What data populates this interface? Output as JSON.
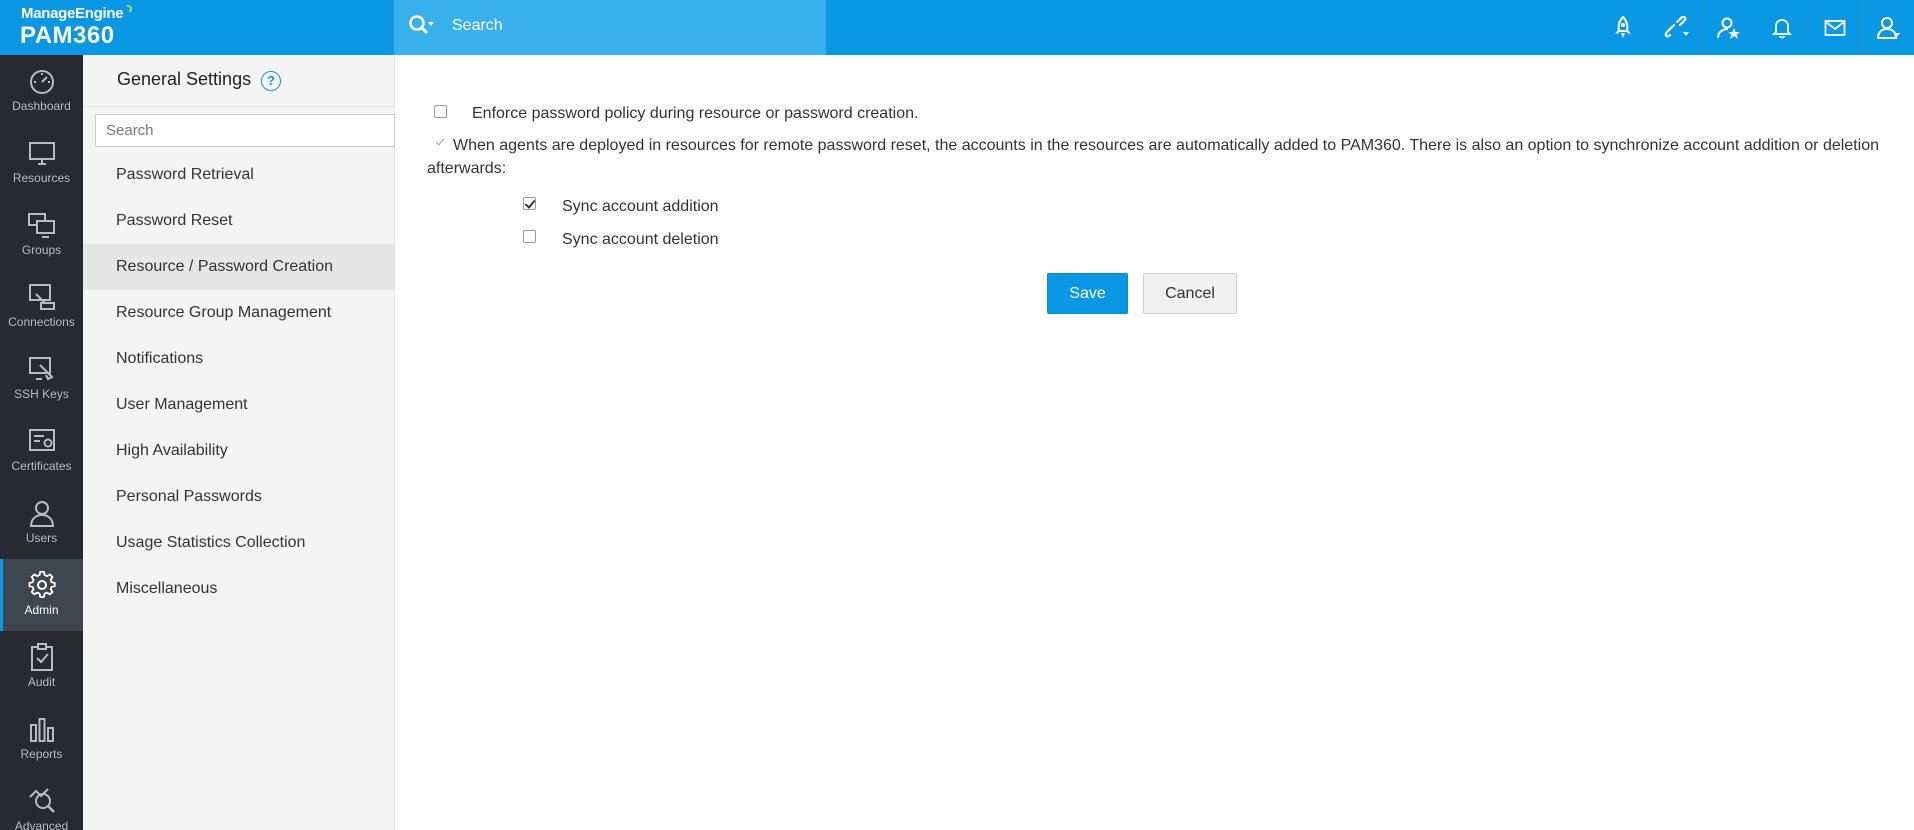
{
  "brand": {
    "vendor": "ManageEngine",
    "product": "PAM360"
  },
  "search": {
    "label": "Search"
  },
  "top_icons": [
    "rocket-icon",
    "link-icon",
    "star-person-icon",
    "bell-icon",
    "mail-icon",
    "user-icon"
  ],
  "leftnav": {
    "items": [
      {
        "label": "Dashboard",
        "icon": "dashboard-icon"
      },
      {
        "label": "Resources",
        "icon": "monitor-icon"
      },
      {
        "label": "Groups",
        "icon": "groups-icon"
      },
      {
        "label": "Connections",
        "icon": "connections-icon"
      },
      {
        "label": "SSH Keys",
        "icon": "ssh-keys-icon"
      },
      {
        "label": "Certificates",
        "icon": "certificates-icon"
      },
      {
        "label": "Users",
        "icon": "users-icon"
      },
      {
        "label": "Admin",
        "icon": "gear-icon",
        "active": true
      },
      {
        "label": "Audit",
        "icon": "audit-icon"
      },
      {
        "label": "Reports",
        "icon": "reports-icon"
      },
      {
        "label": "Advanced",
        "icon": "advanced-icon"
      }
    ]
  },
  "settings": {
    "title": "General Settings",
    "help": "?",
    "search_placeholder": "Search",
    "menu": [
      "Password Retrieval",
      "Password Reset",
      "Resource / Password Creation",
      "Resource Group Management",
      "Notifications",
      "User Management",
      "High Availability",
      "Personal Passwords",
      "Usage Statistics Collection",
      "Miscellaneous"
    ],
    "active_index": 2
  },
  "main": {
    "enforce_policy": {
      "label": "Enforce password policy during resource or password creation.",
      "checked": false
    },
    "agents_note": {
      "text": "When agents are deployed in resources for remote password reset, the accounts in the resources are automatically added to PAM360. There is also an option to synchronize account addition or deletion afterwards:",
      "checked": true,
      "disabled": true
    },
    "sync_addition": {
      "label": "Sync account addition",
      "checked": true
    },
    "sync_deletion": {
      "label": "Sync account deletion",
      "checked": false
    },
    "save_label": "Save",
    "cancel_label": "Cancel"
  },
  "colors": {
    "brand_blue": "#0a97e3",
    "search_blue": "#38b0ec",
    "nav_dark": "#272b31"
  }
}
